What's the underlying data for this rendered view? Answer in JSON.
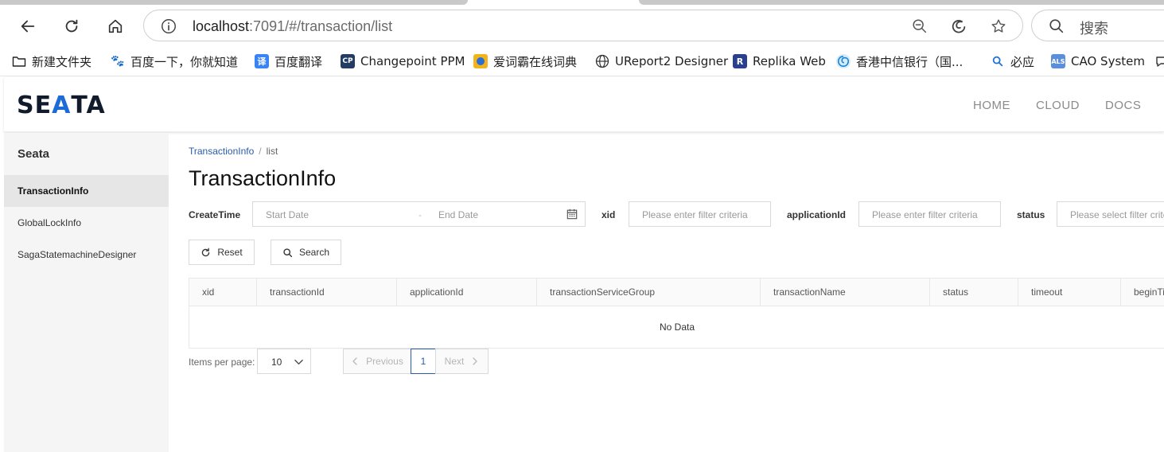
{
  "browser": {
    "url_host": "localhost",
    "url_rest": ":7091/#/transaction/list",
    "search_placeholder": "搜索"
  },
  "bookmarks": [
    {
      "label": "新建文件夹",
      "icon": "folder-icon"
    },
    {
      "label": "百度一下，你就知道",
      "icon": "baidu-paw-icon"
    },
    {
      "label": "百度翻译",
      "icon": "translate-icon"
    },
    {
      "label": "Changepoint PPM",
      "icon": "changepoint-icon"
    },
    {
      "label": "爱词霸在线词典",
      "icon": "iciba-icon"
    },
    {
      "label": "UReport2 Designer",
      "icon": "globe-icon"
    },
    {
      "label": "Replika Web",
      "icon": "replika-icon"
    },
    {
      "label": "香港中信银行（国...",
      "icon": "bank-swirl-icon"
    },
    {
      "label": "必应",
      "icon": "bing-search-icon"
    },
    {
      "label": "CAO System",
      "icon": "als-icon"
    }
  ],
  "header": {
    "logo_part1": "SE",
    "logo_part2": "A",
    "logo_part3": "TA",
    "nav": [
      "HOME",
      "CLOUD",
      "DOCS"
    ]
  },
  "sidebar": {
    "brand": "Seata",
    "items": [
      "TransactionInfo",
      "GlobalLockInfo",
      "SagaStatemachineDesigner"
    ],
    "active_index": 0
  },
  "breadcrumb": {
    "parent": "TransactionInfo",
    "separator": "/",
    "current": "list"
  },
  "page_title": "TransactionInfo",
  "filters": {
    "create_time_label": "CreateTime",
    "start_date_placeholder": "Start Date",
    "range_separator": "-",
    "end_date_placeholder": "End Date",
    "xid_label": "xid",
    "xid_placeholder": "Please enter filter criteria",
    "application_label": "applicationId",
    "application_placeholder": "Please enter filter criteria",
    "status_label": "status",
    "status_placeholder": "Please select filter criteria"
  },
  "actions": {
    "reset": "Reset",
    "search": "Search"
  },
  "table": {
    "columns": [
      "xid",
      "transactionId",
      "applicationId",
      "transactionServiceGroup",
      "transactionName",
      "status",
      "timeout",
      "beginTime"
    ],
    "empty_text": "No Data"
  },
  "pagination": {
    "items_per_page_label": "Items per page:",
    "page_size": "10",
    "previous": "Previous",
    "current_page": "1",
    "next": "Next"
  },
  "colors": {
    "accent": "#2a5caa",
    "logo_blue": "#1c6bd6",
    "sidebar_bg": "#f5f5f5"
  }
}
